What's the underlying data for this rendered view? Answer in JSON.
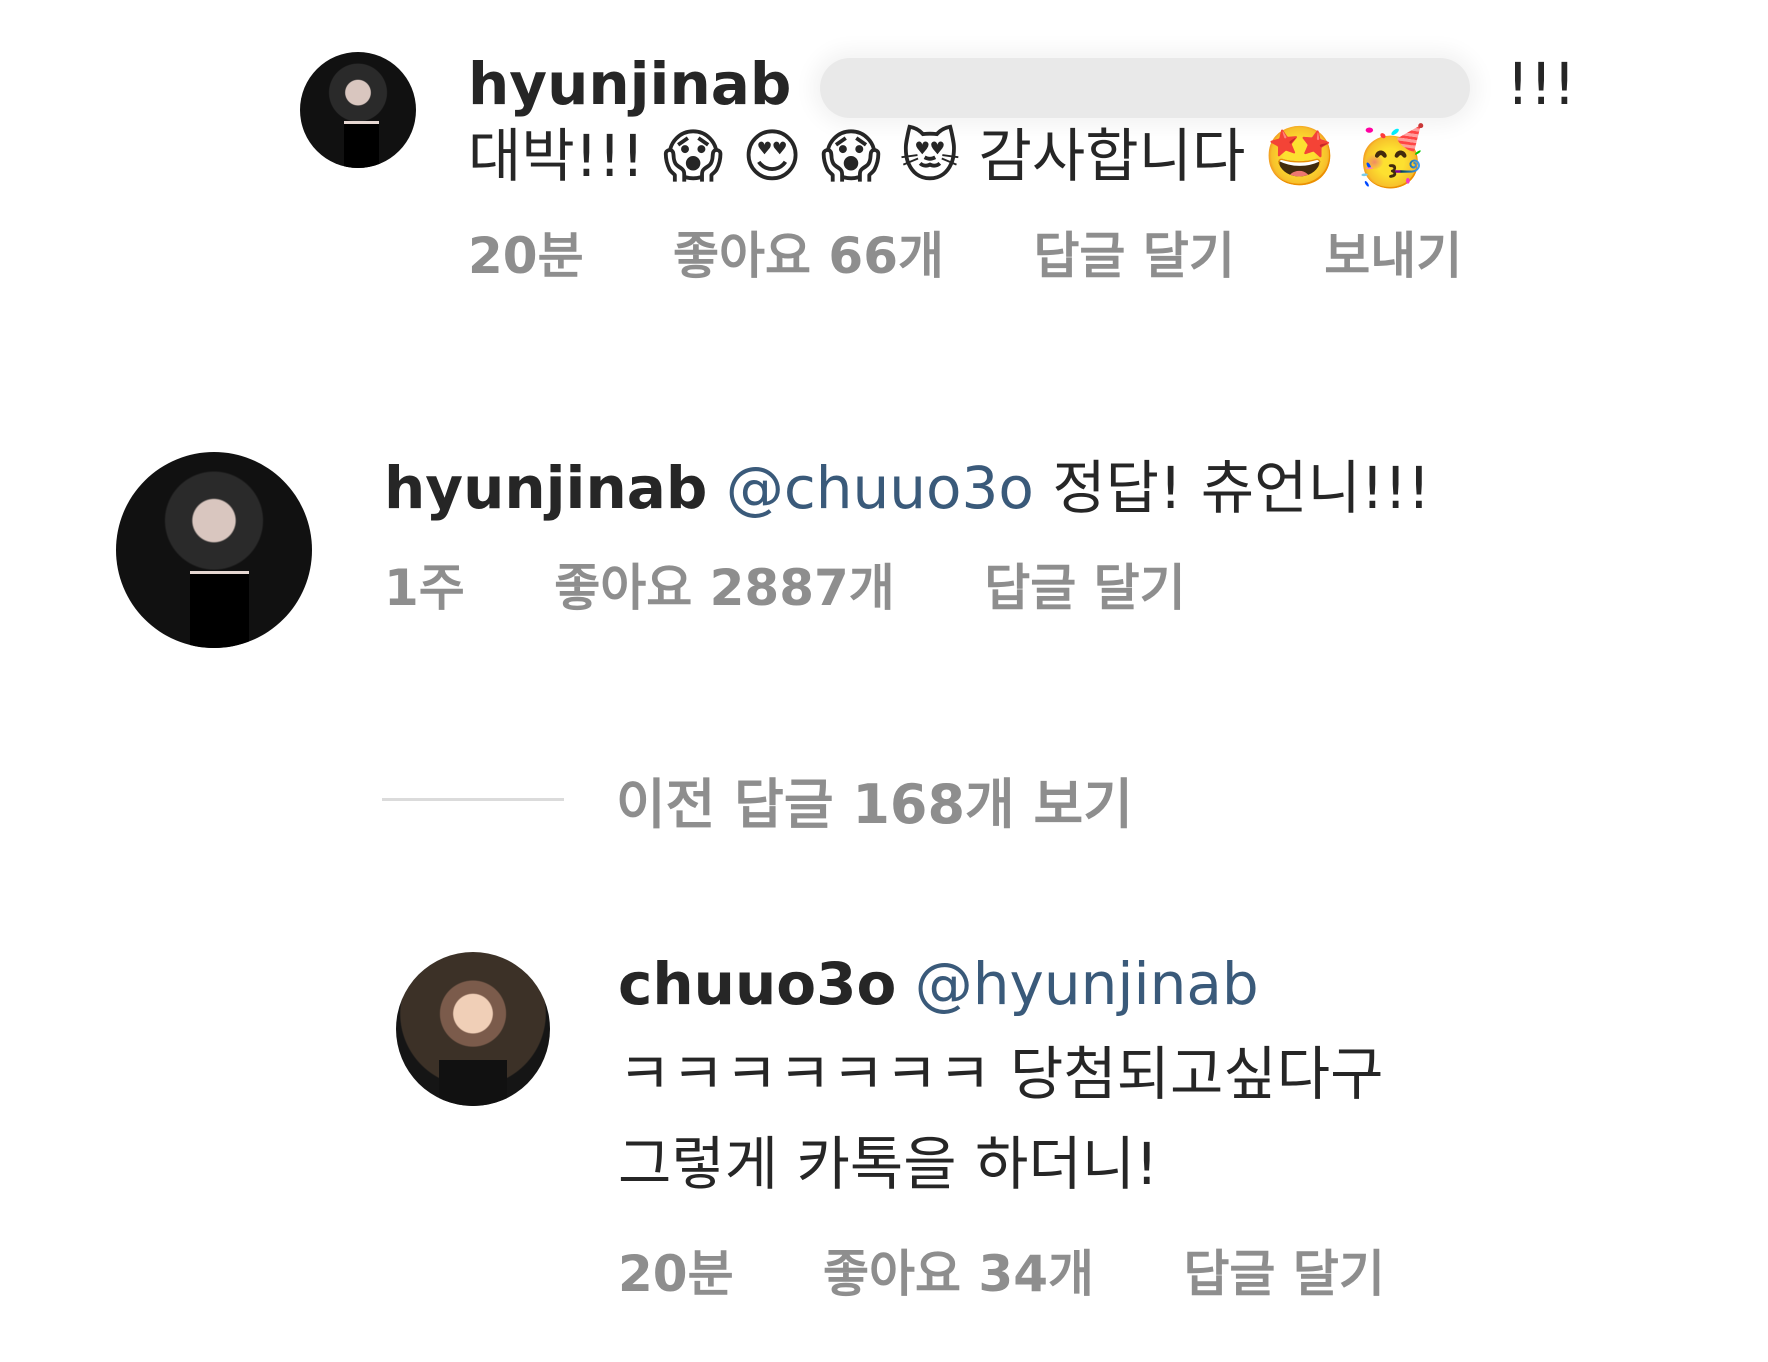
{
  "comments": [
    {
      "username": "hyunjinab",
      "text_line1_tail": "!!!",
      "text_line2": "대박!!!",
      "emojis_line2": [
        "😱",
        "😍",
        "😱",
        "😻"
      ],
      "text_line2_tail": "감사합니다",
      "emojis_line2_tail": [
        "🤩",
        "🥳"
      ],
      "meta": {
        "time": "20분",
        "likes": "좋아요 66개",
        "reply": "답글 달기",
        "send": "보내기"
      }
    },
    {
      "username": "hyunjinab",
      "mention": "@chuuo3o",
      "text": "정답! 츄언니!!!",
      "meta": {
        "time": "1주",
        "likes": "좋아요 2887개",
        "reply": "답글 달기"
      }
    },
    {
      "username": "chuuo3o",
      "mention": "@hyunjinab",
      "text_line2": "ㅋㅋㅋㅋㅋㅋㅋ 당첨되고싶다구",
      "text_line3": "그렇게 카톡을 하더니!",
      "meta": {
        "time": "20분",
        "likes": "좋아요 34개",
        "reply": "답글 달기"
      }
    }
  ],
  "view_previous_replies": "이전 답글 168개 보기",
  "icons": {
    "avatar": "profile-avatar"
  }
}
